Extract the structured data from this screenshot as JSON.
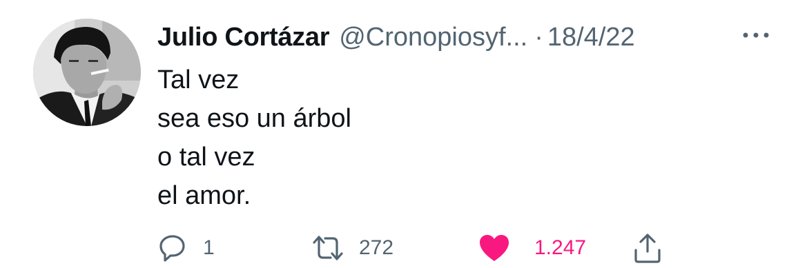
{
  "tweet": {
    "author_name": "Julio Cortázar",
    "handle": "@Cronopiosyf...",
    "separator": "·",
    "date": "18/4/22",
    "lines": [
      "Tal vez",
      "sea eso un árbol",
      "o tal vez",
      "el amor."
    ],
    "avatar": "avatar-photo"
  },
  "actions": {
    "reply": {
      "icon": "reply-icon",
      "count": "1"
    },
    "retweet": {
      "icon": "retweet-icon",
      "count": "272"
    },
    "like": {
      "icon": "heart-icon",
      "count": "1.247",
      "active": true,
      "color": "#f91880"
    },
    "share": {
      "icon": "share-icon"
    }
  },
  "colors": {
    "text_primary": "#0f1419",
    "text_secondary": "#536471",
    "like_active": "#f91880"
  }
}
